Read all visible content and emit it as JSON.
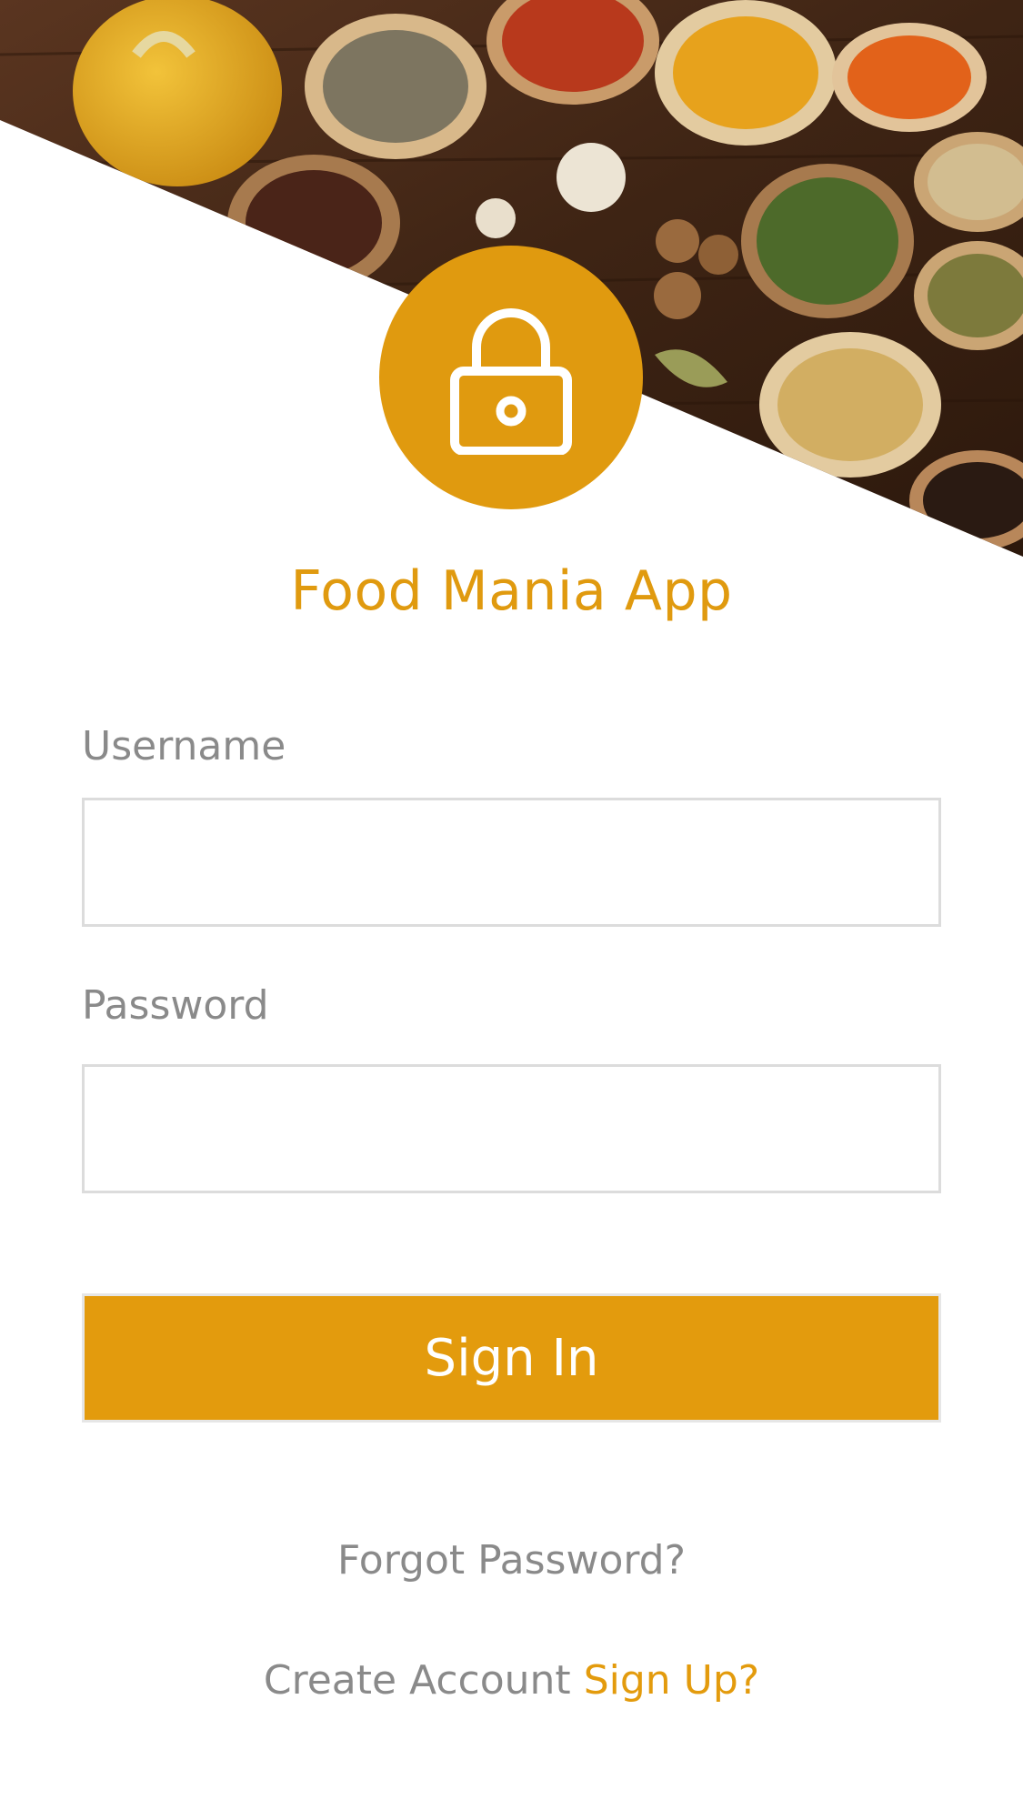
{
  "hero": {
    "image_icon": "spices-photo",
    "description_colors": {
      "wood": "#4a2a16",
      "accent": "#E09A0F"
    }
  },
  "badge": {
    "icon": "lock-icon",
    "color": "#E09A0F"
  },
  "app": {
    "title": "Food Mania App"
  },
  "form": {
    "username_label": "Username",
    "username_value": "",
    "password_label": "Password",
    "password_value": "",
    "signin_label": "Sign In"
  },
  "footer": {
    "forgot_label": "Forgot Password?",
    "create_account_text": "Create Account",
    "signup_label": "Sign Up?"
  },
  "colors": {
    "brand": "#E39B0D",
    "label_gray": "#8a8a8a",
    "field_border": "#dcdcdc"
  }
}
